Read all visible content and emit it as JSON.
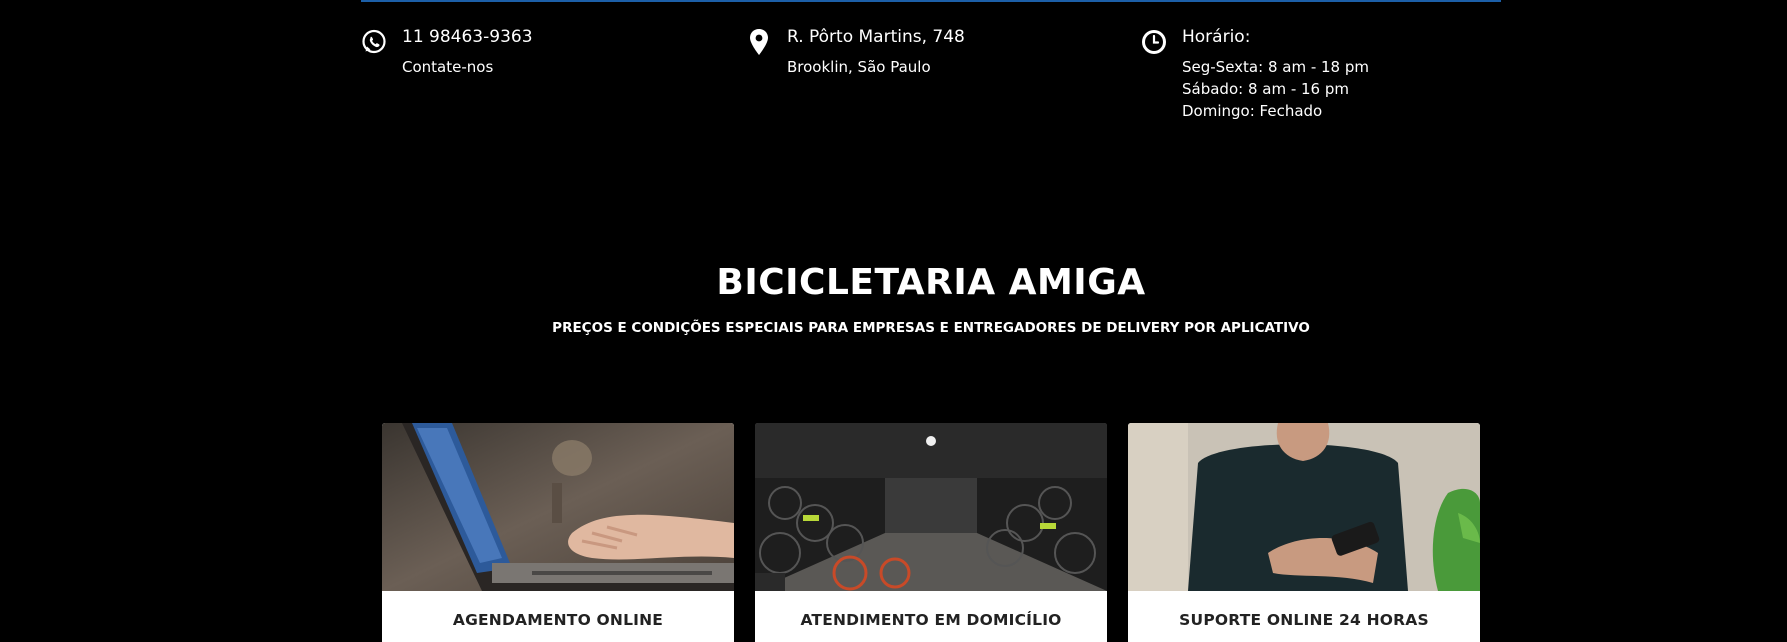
{
  "colors": {
    "background": "#000000",
    "accent_rule": "#1c5fa8",
    "text": "#ffffff",
    "card_title": "#222222"
  },
  "contact": {
    "phone": {
      "icon": "whatsapp-icon",
      "number": "11 98463-9363",
      "label": "Contate-nos"
    },
    "address": {
      "icon": "map-pin-icon",
      "street": "R. Pôrto Martins, 748",
      "district": "Brooklin, São Paulo"
    },
    "hours": {
      "icon": "clock-icon",
      "title": "Horário:",
      "lines": [
        "Seg-Sexta: 8 am - 18 pm",
        "Sábado: 8 am - 16 pm",
        "Domingo: Fechado"
      ]
    }
  },
  "hero": {
    "title": "BICICLETARIA AMIGA",
    "subtitle": "PREÇOS E CONDIÇÕES ESPECIAIS PARA EMPRESAS E ENTREGADORES DE DELIVERY POR APLICATIVO"
  },
  "cards": [
    {
      "title": "AGENDAMENTO ONLINE"
    },
    {
      "title": "ATENDIMENTO EM DOMICÍLIO"
    },
    {
      "title": "SUPORTE ONLINE 24 HORAS"
    }
  ]
}
